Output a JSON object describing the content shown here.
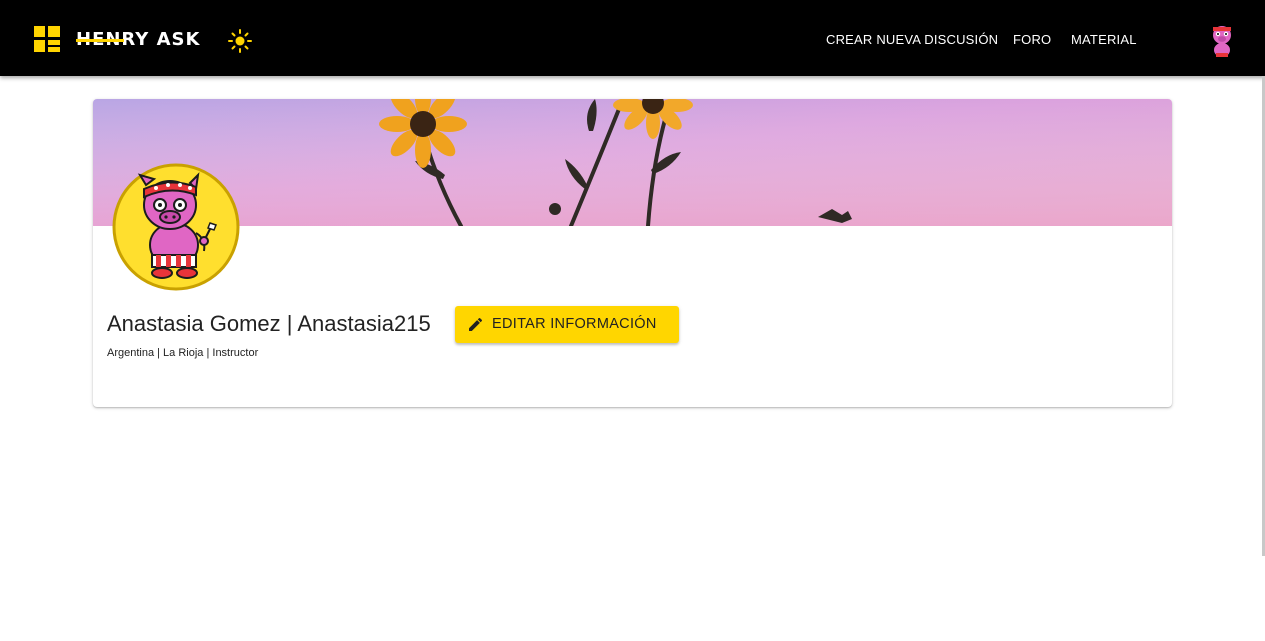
{
  "app": {
    "brand": "HENRY ASK",
    "brand_color": "#ffd400",
    "theme_icon": "sun-icon"
  },
  "nav": {
    "items": [
      {
        "label": "CREAR NUEVA DISCUSIÓN"
      },
      {
        "label": "FORO"
      },
      {
        "label": "MATERIAL"
      }
    ],
    "avatar_icon": "pig-avatar-icon"
  },
  "profile": {
    "name": "Anastasia Gomez | Anastasia215",
    "subtitle": "Argentina | La Rioja | Instructor",
    "edit_label": "EDITAR INFORMACIÓN",
    "edit_icon": "pencil-icon",
    "cover": "sunflowers-on-pink-sky",
    "avatar": "pig-mascot"
  },
  "colors": {
    "topbar": "#000000",
    "button": "#ffd600",
    "avatar_bg": "#ffdf2e"
  }
}
